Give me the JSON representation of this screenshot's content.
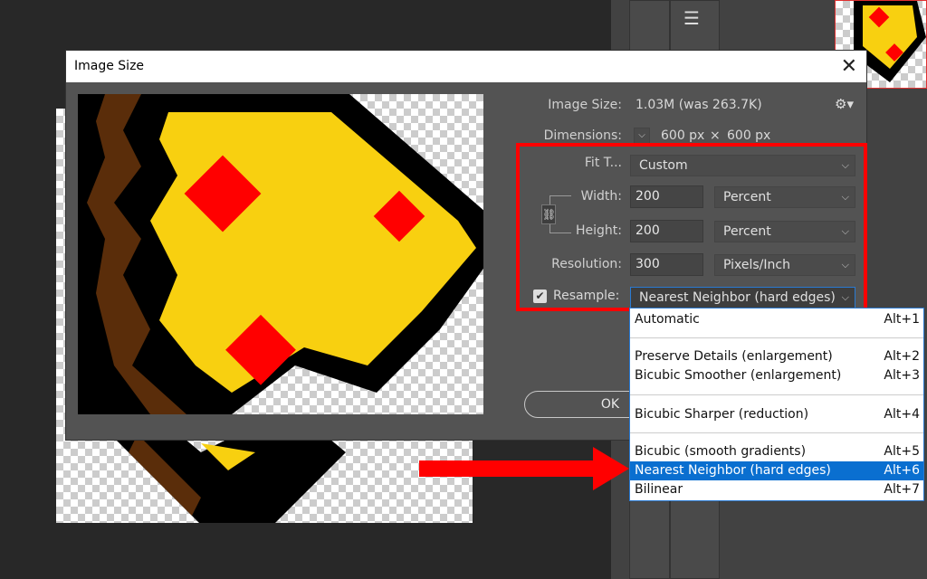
{
  "dialog": {
    "title": "Image Size",
    "image_size_label": "Image Size:",
    "image_size_value": "1.03M (was 263.7K)",
    "dimensions_label": "Dimensions:",
    "dimensions_w": "600 px",
    "dimensions_x": "×",
    "dimensions_h": "600 px",
    "fit_to_label": "Fit T...",
    "fit_to_value": "Custom",
    "width_label": "Width:",
    "width_value": "200",
    "width_unit": "Percent",
    "height_label": "Height:",
    "height_value": "200",
    "height_unit": "Percent",
    "resolution_label": "Resolution:",
    "resolution_value": "300",
    "resolution_unit": "Pixels/Inch",
    "resample_label": "Resample:",
    "resample_checked": true,
    "resample_value": "Nearest Neighbor (hard edges)",
    "ok_label": "OK"
  },
  "resample_menu": [
    {
      "label": "Automatic",
      "shortcut": "Alt+1"
    },
    {
      "label": "Preserve Details (enlargement)",
      "shortcut": "Alt+2"
    },
    {
      "label": "Bicubic Smoother (enlargement)",
      "shortcut": "Alt+3"
    },
    {
      "label": "Bicubic Sharper (reduction)",
      "shortcut": "Alt+4"
    },
    {
      "label": "Bicubic (smooth gradients)",
      "shortcut": "Alt+5"
    },
    {
      "label": "Nearest Neighbor (hard edges)",
      "shortcut": "Alt+6",
      "selected": true
    },
    {
      "label": "Bilinear",
      "shortcut": "Alt+7"
    }
  ],
  "colors": {
    "highlight": "#f00000",
    "menu_selected": "#0a6fd0",
    "dialog_bg": "#535353"
  }
}
